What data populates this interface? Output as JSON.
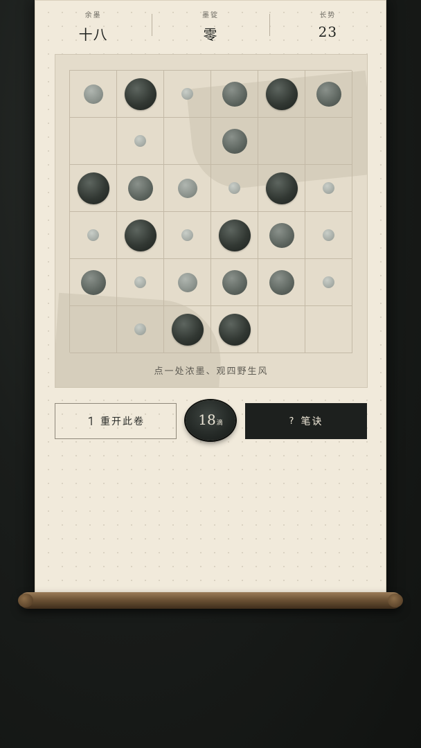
{
  "stats": [
    {
      "label": "余墨",
      "value": "十八"
    },
    {
      "label": "墨锭",
      "value": "零"
    },
    {
      "label": "长势",
      "value": "23"
    }
  ],
  "board": {
    "rows": 6,
    "cols": 6,
    "ink_levels": [
      [
        1,
        3,
        0,
        2,
        3,
        2
      ],
      [
        -1,
        0,
        -1,
        2,
        -1,
        -1
      ],
      [
        3,
        2,
        1,
        0,
        3,
        0
      ],
      [
        0,
        3,
        0,
        3,
        2,
        0
      ],
      [
        2,
        0,
        1,
        2,
        2,
        0
      ],
      [
        -1,
        0,
        3,
        3,
        -1,
        -1
      ]
    ]
  },
  "hint": "点一处浓墨、观四野生风",
  "buttons": {
    "restart_label": "重开此卷",
    "secret_label": "笔诀",
    "secret_icon": "?"
  },
  "counter": {
    "value": "18",
    "unit": "滴"
  },
  "colors": {
    "paper": "#f1eadb",
    "ink_dark": "#1d201e",
    "rod": "#6d5335"
  }
}
